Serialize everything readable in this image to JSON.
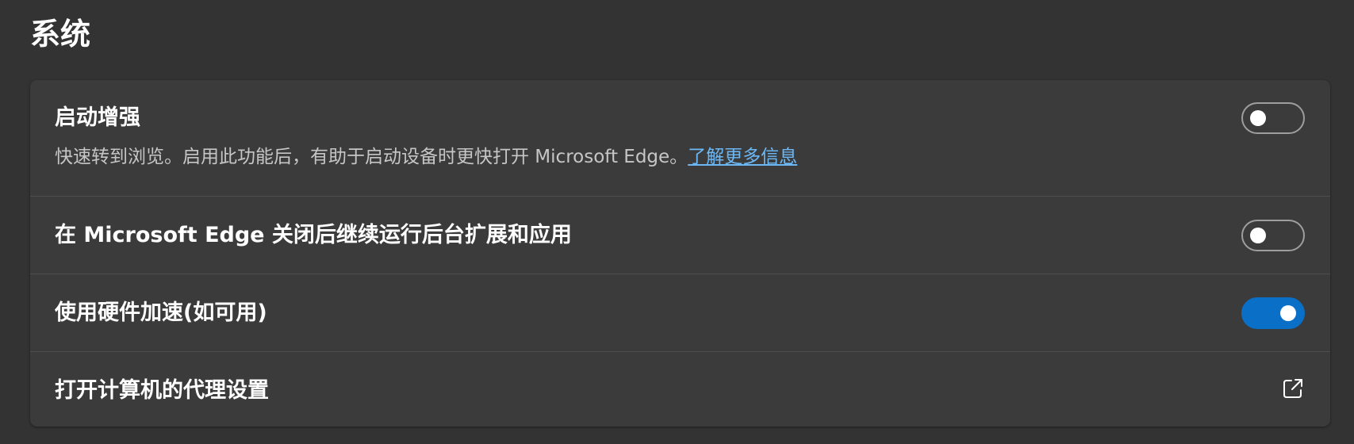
{
  "section": {
    "title": "系统"
  },
  "settings": [
    {
      "label": "启动增强",
      "description": "快速转到浏览。启用此功能后，有助于启动设备时更快打开 Microsoft Edge。",
      "link_text": "了解更多信息",
      "toggle_on": false
    },
    {
      "label": "在 Microsoft Edge 关闭后继续运行后台扩展和应用",
      "toggle_on": false
    },
    {
      "label": "使用硬件加速(如可用)",
      "toggle_on": true
    },
    {
      "label": "打开计算机的代理设置",
      "icon": "external-link-icon"
    }
  ],
  "colors": {
    "background": "#333333",
    "card": "#3b3b3b",
    "accent": "#0a6fc7",
    "link": "#6cb8f6"
  }
}
